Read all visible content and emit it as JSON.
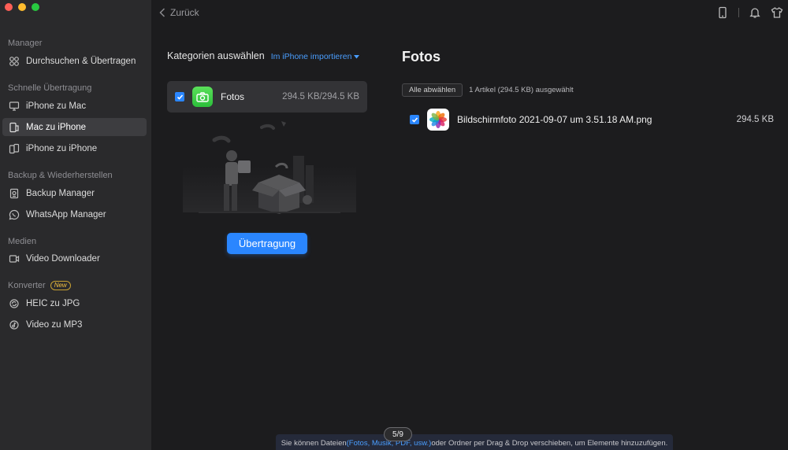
{
  "sidebar": {
    "sections": {
      "manager": "Manager",
      "quick": "Schnelle Übertragung",
      "backup": "Backup & Wiederherstellen",
      "media": "Medien",
      "converter": "Konverter",
      "new_badge": "New"
    },
    "items": [
      {
        "label": "Durchsuchen & Übertragen",
        "icon": "grid-icon"
      },
      {
        "label": "iPhone zu Mac",
        "icon": "monitor-icon"
      },
      {
        "label": "Mac zu iPhone",
        "icon": "phone-icon",
        "active": true
      },
      {
        "label": "iPhone zu iPhone",
        "icon": "phones-icon"
      },
      {
        "label": "Backup Manager",
        "icon": "backup-icon"
      },
      {
        "label": "WhatsApp Manager",
        "icon": "whatsapp-icon"
      },
      {
        "label": "Video Downloader",
        "icon": "download-icon"
      },
      {
        "label": "HEIC zu JPG",
        "icon": "convert-icon"
      },
      {
        "label": "Video zu MP3",
        "icon": "music-icon"
      }
    ]
  },
  "topbar": {
    "back_label": "Zurück"
  },
  "categories": {
    "title": "Kategorien auswählen",
    "import_link": "Im iPhone importieren",
    "item": {
      "label": "Fotos",
      "size": "294.5 KB/294.5 KB"
    }
  },
  "transfer_button": "Übertragung",
  "fotos": {
    "title": "Fotos",
    "select_all": "Alle abwählen",
    "selection_info": "1 Artikel (294.5 KB) ausgewählt",
    "files": [
      {
        "name": "Bildschirmfoto 2021-09-07 um 3.51.18 AM.png",
        "size": "294.5 KB"
      }
    ]
  },
  "bottom_hint": {
    "before": "Sie können Dateien ",
    "link": "(Fotos, Musik, PDF, usw.)",
    "after": " oder Ordner per Drag & Drop verschieben, um Elemente hinzuzufügen."
  },
  "page_indicator": "5/9",
  "colors": {
    "accent": "#2a86ff",
    "sidebar_bg": "#2a2a2c",
    "main_bg": "#1c1c1e"
  }
}
